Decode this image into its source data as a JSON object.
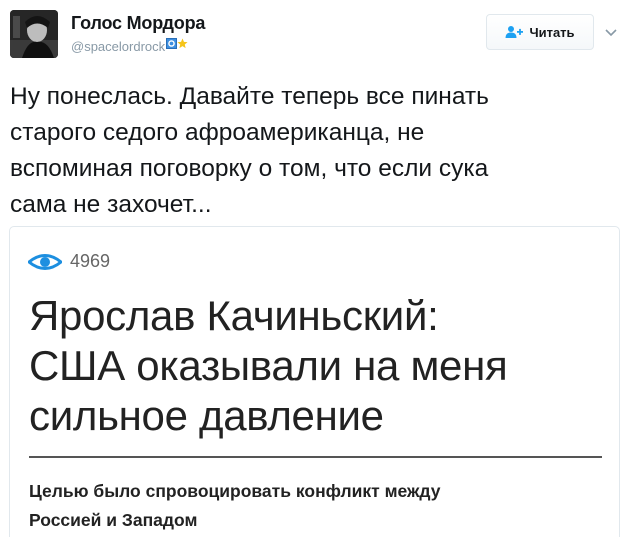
{
  "author": {
    "name": "Голос Мордора",
    "handle": "@spacelordrock"
  },
  "follow_button": {
    "label": "Читать"
  },
  "tweet": {
    "text": "Ну понеслась. Давайте теперь все пинать\nстарого седого афроамериканца, не\nвспоминая поговорку о том, что если сука\nсама не захочет..."
  },
  "card": {
    "views": "4969",
    "headline": "Ярослав Качиньский:\nСША оказывали на меня\nсильное давление",
    "lead": "Целью было спровоцировать конфликт между\nРоссией и Западом"
  },
  "icons": {
    "avatar": "user-avatar",
    "badge_1": "blue-square-badge-icon",
    "badge_2": "star-badge-icon",
    "follow": "add-user-icon",
    "caret": "chevron-down-icon",
    "views": "eye-icon"
  },
  "colors": {
    "accent": "#1da1f2",
    "text": "#14171a",
    "muted": "#8899a6",
    "star": "#f5c41a"
  }
}
